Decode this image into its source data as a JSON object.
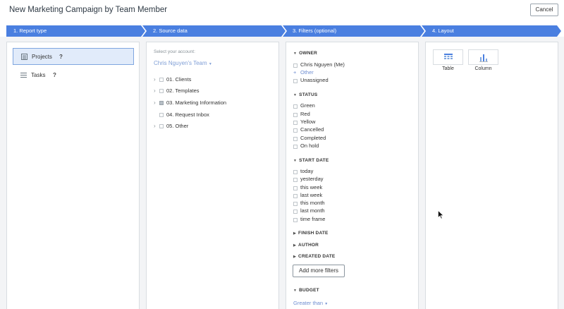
{
  "dialog": {
    "title": "New Marketing Campaign by Team Member",
    "cancel_label": "Cancel"
  },
  "steps": [
    {
      "label": "1. Report type"
    },
    {
      "label": "2. Source data"
    },
    {
      "label": "3. Filters (optional)"
    },
    {
      "label": "4. Layout"
    }
  ],
  "report_type": {
    "items": [
      {
        "label": "Projects",
        "help": "?",
        "icon": "projects-icon",
        "selected": true
      },
      {
        "label": "Tasks",
        "help": "?",
        "icon": "tasks-icon",
        "selected": false
      }
    ]
  },
  "source_data": {
    "account_label": "Select your account:",
    "account_value": "Chris Nguyen's Team",
    "folders": [
      {
        "label": "01. Clients",
        "expandable": true,
        "checked": false
      },
      {
        "label": "02. Templates",
        "expandable": true,
        "checked": false
      },
      {
        "label": "03. Marketing Information",
        "expandable": true,
        "checked": "partial"
      },
      {
        "label": "04. Request Inbox",
        "expandable": false,
        "checked": false
      },
      {
        "label": "05. Other",
        "expandable": true,
        "checked": false
      }
    ]
  },
  "filters": {
    "owner": {
      "heading": "OWNER",
      "options": [
        "Chris Nguyen (Me)",
        "Unassigned"
      ],
      "other_label": "Other"
    },
    "status": {
      "heading": "STATUS",
      "options": [
        "Green",
        "Red",
        "Yellow",
        "Cancelled",
        "Completed",
        "On hold"
      ]
    },
    "start_date": {
      "heading": "START DATE",
      "options": [
        "today",
        "yesterday",
        "this week",
        "last week",
        "this month",
        "last month",
        "time frame"
      ]
    },
    "collapsed": [
      "FINISH DATE",
      "AUTHOR",
      "CREATED DATE"
    ],
    "add_more_label": "Add more filters",
    "budget": {
      "heading": "BUDGET",
      "select_value": "Greater than"
    }
  },
  "layout": {
    "options": [
      {
        "label": "Table",
        "icon": "table-icon"
      },
      {
        "label": "Column",
        "icon": "column-chart-icon"
      }
    ]
  },
  "colors": {
    "step_bar": "#4a7fe0",
    "selected_bg": "#e1ebfa",
    "link": "#6f8ed1",
    "panel_bg": "#f3f4f6"
  }
}
